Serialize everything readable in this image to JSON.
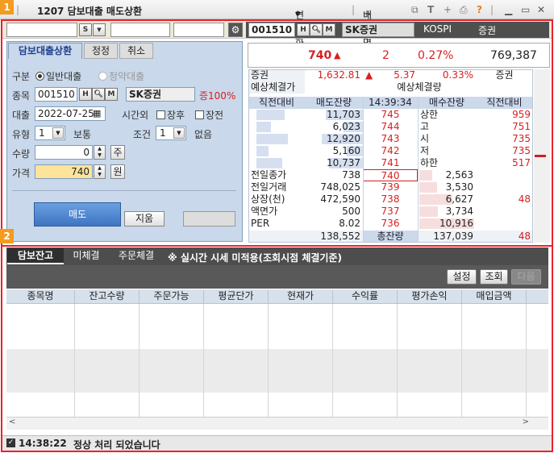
{
  "window": {
    "badge1": "1",
    "badge2": "2",
    "title": "1207 담보대출 매도상환",
    "related": "연관화면",
    "related_arrow": "▾",
    "mine": "내화면",
    "mine_plus": "+",
    "help": "?"
  },
  "toolbar": {
    "s_btn": "S",
    "code": "001510",
    "name": "SK증권",
    "market": "KOSPI",
    "type": "증권",
    "h": "H",
    "m": "M"
  },
  "tabs": [
    "담보대출상환",
    "정정",
    "취소"
  ],
  "form": {
    "gubun_label": "구분",
    "opt1": "일반대출",
    "opt2": "청약대출",
    "code_label": "종목",
    "code": "001510",
    "name": "SK증권",
    "rate": "증100%",
    "loan_label": "대출",
    "loan_date": "2022-07-25",
    "after_label": "시간외",
    "after1": "장후",
    "after2": "장전",
    "type_label": "유형",
    "type_val": "1",
    "type_text": "보통",
    "cond_label": "조건",
    "cond_val": "1",
    "cond_text": "없음",
    "qty_label": "수량",
    "qty": "0",
    "qty_unit": "주",
    "price_label": "가격",
    "price": "740",
    "price_unit": "원",
    "sell_btn": "매도",
    "clear_btn": "지움"
  },
  "quote": {
    "price": "740",
    "arrow": "▲",
    "change": "2",
    "pct": "0.27%",
    "volume": "769,387",
    "sector_label": "증권",
    "sector_val": "1,632.81",
    "sector_arrow": "▲",
    "sector_chg": "5.37",
    "sector_pct": "0.33%",
    "sector_name": "증권",
    "exp_price_label": "예상체결가",
    "exp_qty_label": "예상체결량",
    "headers": [
      "직전대비",
      "매도잔량",
      "14:39:34",
      "매수잔량",
      "직전대비"
    ],
    "asks": [
      {
        "qty": "11,703",
        "price": "745",
        "bar": 0.64
      },
      {
        "qty": "6,023",
        "price": "744",
        "bar": 0.33
      },
      {
        "qty": "12,920",
        "price": "743",
        "bar": 0.71
      },
      {
        "qty": "5,160",
        "price": "742",
        "bar": 0.28
      },
      {
        "qty": "10,737",
        "price": "741",
        "bar": 0.59
      }
    ],
    "right_info": [
      {
        "label": "상한",
        "val": "959"
      },
      {
        "label": "고",
        "val": "751"
      },
      {
        "label": "시",
        "val": "735"
      },
      {
        "label": "저",
        "val": "735"
      },
      {
        "label": "하한",
        "val": "517"
      }
    ],
    "left_info": [
      {
        "label": "전일종가",
        "val": "738"
      },
      {
        "label": "전일거래",
        "val": "748,025"
      },
      {
        "label": "상장(천)",
        "val": "472,590"
      },
      {
        "label": "액면가",
        "val": "500"
      },
      {
        "label": "PER",
        "val": "8.02"
      }
    ],
    "bids": [
      {
        "price": "740",
        "qty": "2,563",
        "bar": 0.23
      },
      {
        "price": "739",
        "qty": "3,530",
        "bar": 0.32
      },
      {
        "price": "738",
        "qty": "6,627",
        "bar": 0.61
      },
      {
        "price": "737",
        "qty": "3,734",
        "bar": 0.34
      },
      {
        "price": "736",
        "qty": "10,916",
        "bar": 1.0
      }
    ],
    "bid_extra": {
      "row": 2,
      "val": "48"
    },
    "total_sell": "138,552",
    "total_label": "총잔량",
    "total_buy": "137,039",
    "total_diff": "48"
  },
  "grid": {
    "tabs": [
      "담보잔고",
      "미체결",
      "주문체결"
    ],
    "notice": "※ 실시간 시세 미적용(조회시점 체결기준)",
    "btns": [
      "설정",
      "조회",
      "다음"
    ],
    "columns": [
      "종목명",
      "잔고수량",
      "주문가능",
      "평균단가",
      "현재가",
      "수익률",
      "평가손익",
      "매입금액"
    ]
  },
  "status": {
    "time": "14:38:22",
    "msg": "정상 처리 되었습니다"
  }
}
